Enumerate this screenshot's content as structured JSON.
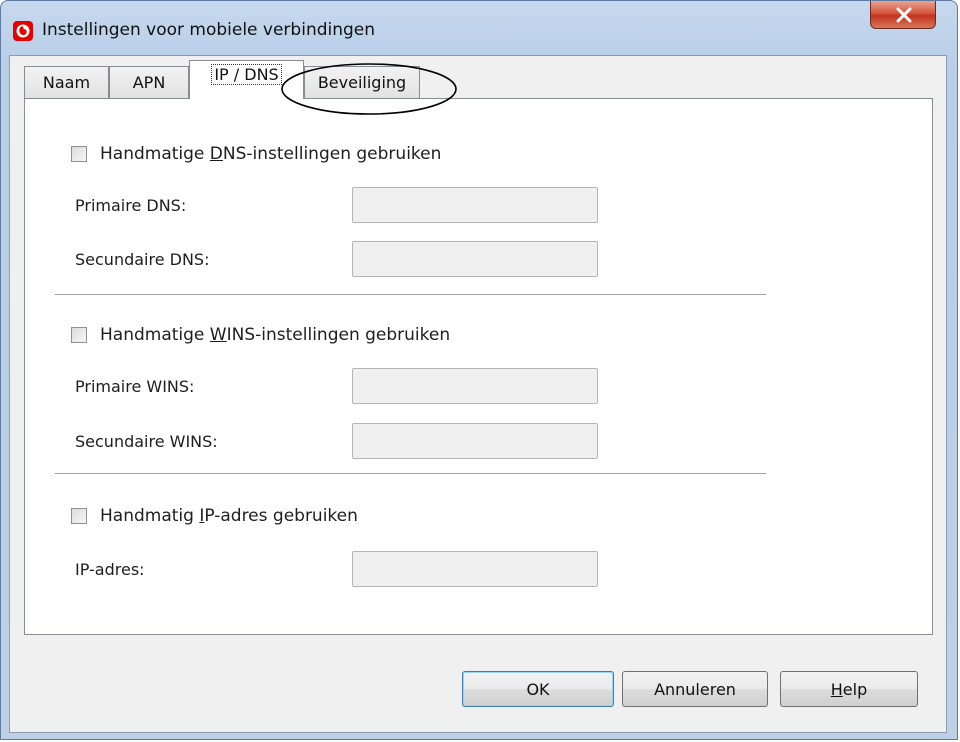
{
  "window": {
    "title": "Instellingen voor mobiele verbindingen",
    "close_glyph": "X",
    "icon": "vodafone-logo-icon"
  },
  "tabs": [
    {
      "label": "Naam",
      "active": false
    },
    {
      "label": "APN",
      "active": false
    },
    {
      "label": "IP / DNS",
      "active": true
    },
    {
      "label": "Beveiliging",
      "active": false
    }
  ],
  "dns": {
    "checkbox_pre": "Handmatige ",
    "checkbox_key": "D",
    "checkbox_post": "NS-instellingen gebruiken",
    "checked": false,
    "primary_label": "Primaire DNS:",
    "primary_value": "",
    "secondary_label": "Secundaire DNS:",
    "secondary_value": ""
  },
  "wins": {
    "checkbox_pre": "Handmatige ",
    "checkbox_key": "W",
    "checkbox_post": "INS-instellingen gebruiken",
    "checked": false,
    "primary_label": "Primaire WINS:",
    "primary_value": "",
    "secondary_label": "Secundaire WINS:",
    "secondary_value": ""
  },
  "ip": {
    "checkbox_pre": "Handmatig ",
    "checkbox_key": "I",
    "checkbox_post": "P-adres gebruiken",
    "checked": false,
    "address_label": "IP-adres:",
    "address_value": ""
  },
  "buttons": {
    "ok": "OK",
    "cancel": "Annuleren",
    "help_key": "H",
    "help_rest": "elp"
  },
  "colors": {
    "title_bar": "#c6d8ee",
    "close_button": "#d5553c",
    "vodafone_red": "#e60000"
  }
}
